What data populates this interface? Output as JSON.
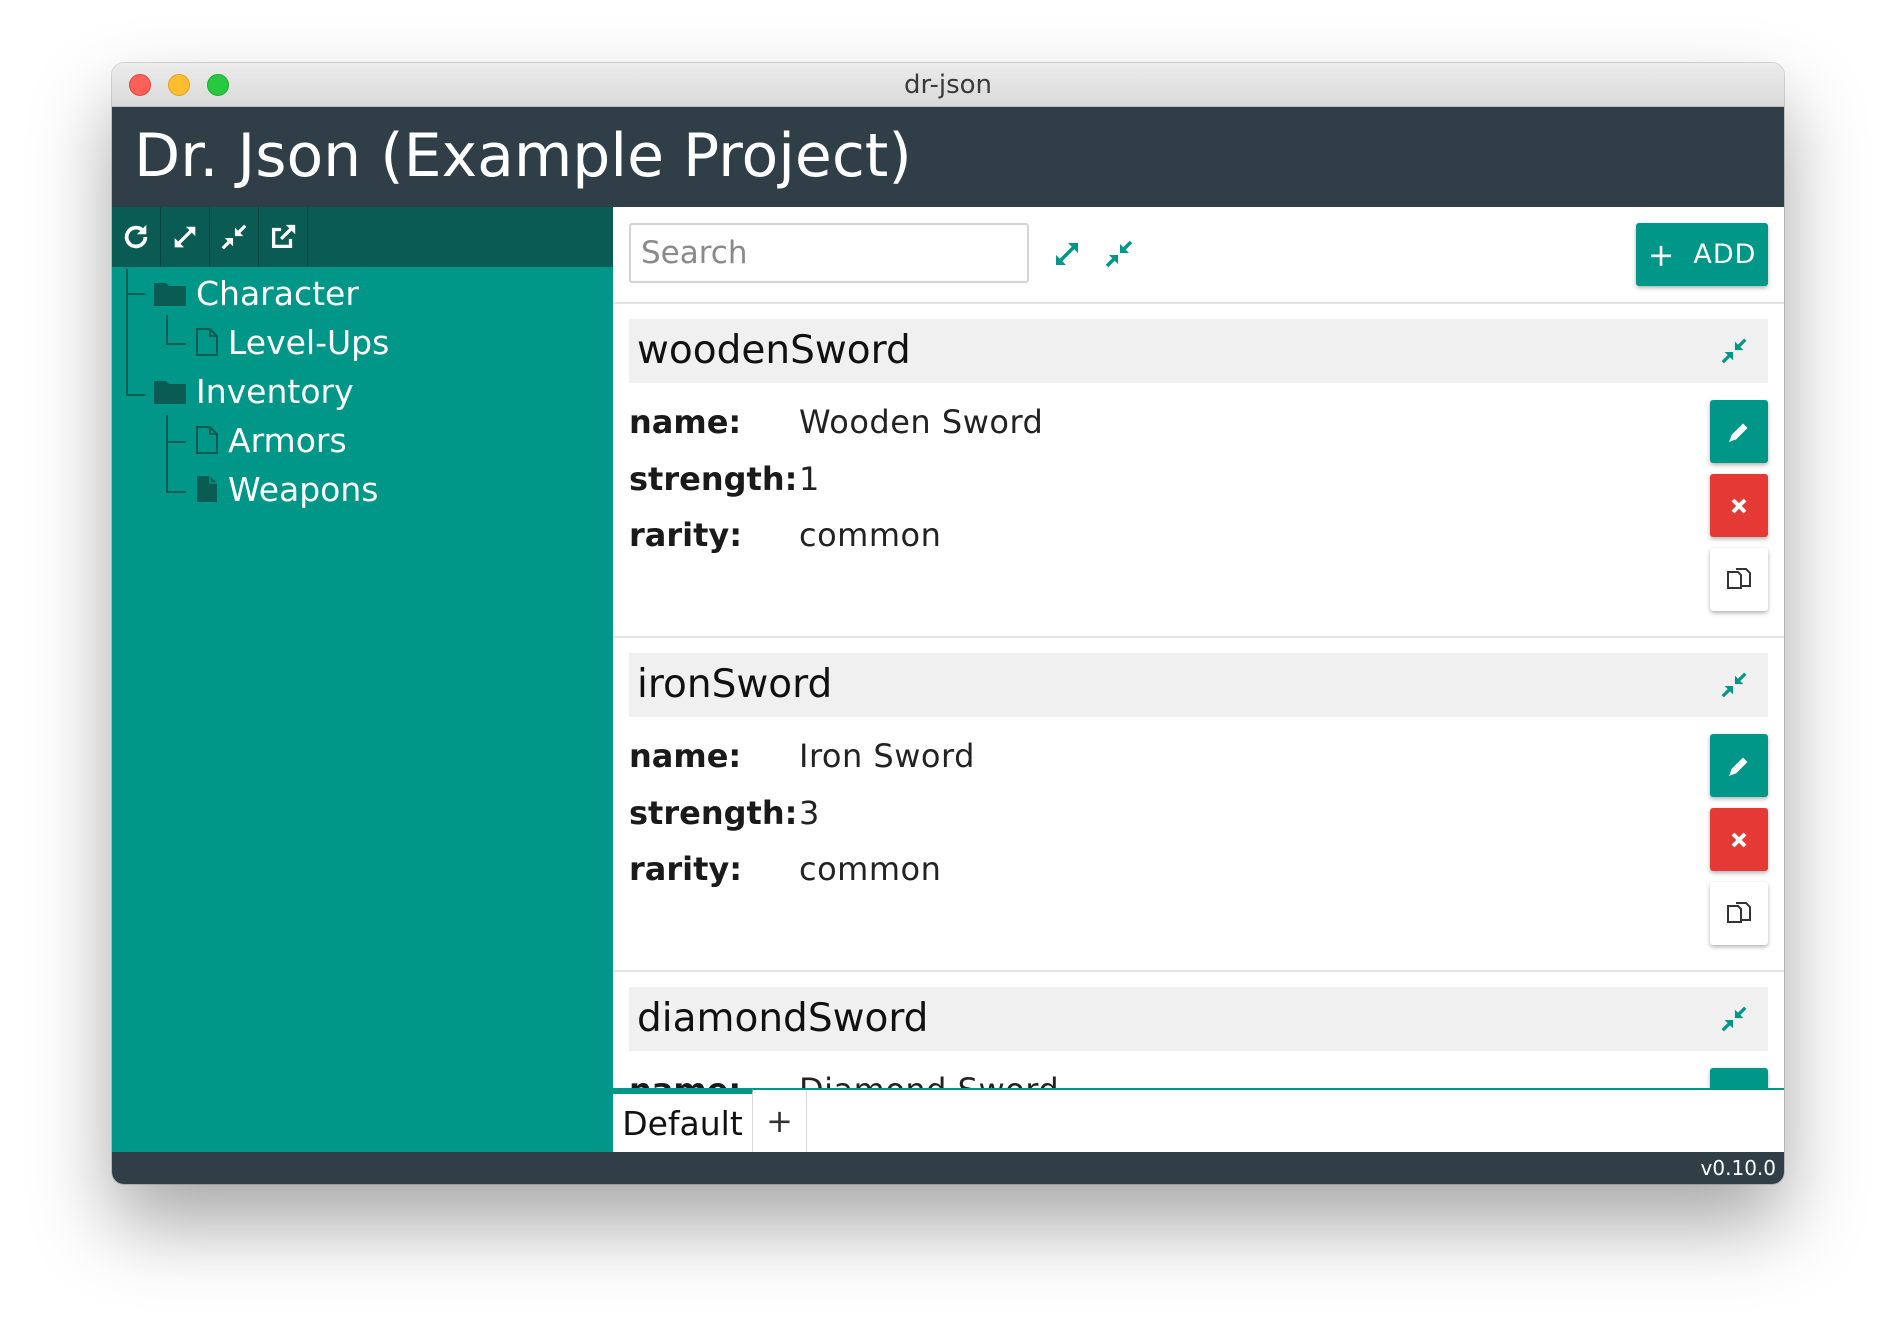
{
  "window": {
    "title": "dr-json"
  },
  "app": {
    "title": "Dr. Json (Example Project)"
  },
  "sidebar": {
    "toolbar": [
      {
        "name": "refresh-icon"
      },
      {
        "name": "expand-all-icon"
      },
      {
        "name": "collapse-all-icon"
      },
      {
        "name": "open-external-icon"
      }
    ],
    "tree": [
      {
        "label": "Character",
        "type": "folder"
      },
      {
        "label": "Level-Ups",
        "type": "file"
      },
      {
        "label": "Inventory",
        "type": "folder"
      },
      {
        "label": "Armors",
        "type": "file"
      },
      {
        "label": "Weapons",
        "type": "file",
        "selected": true
      }
    ]
  },
  "main": {
    "search": {
      "placeholder": "Search",
      "value": ""
    },
    "add_button": {
      "icon": "+",
      "label": "ADD"
    },
    "records": [
      {
        "id": "woodenSword",
        "fields": [
          {
            "key": "name:",
            "value": "Wooden Sword"
          },
          {
            "key": "strength:",
            "value": "1"
          },
          {
            "key": "rarity:",
            "value": "common"
          }
        ]
      },
      {
        "id": "ironSword",
        "fields": [
          {
            "key": "name:",
            "value": "Iron Sword"
          },
          {
            "key": "strength:",
            "value": "3"
          },
          {
            "key": "rarity:",
            "value": "common"
          }
        ]
      },
      {
        "id": "diamondSword",
        "fields": [
          {
            "key": "name:",
            "value": "Diamond Sword"
          }
        ]
      }
    ]
  },
  "tabs": {
    "items": [
      {
        "label": "Default",
        "active": true
      }
    ],
    "add_label": "+"
  },
  "status": {
    "version": "v0.10.0"
  },
  "colors": {
    "accent": "#009688",
    "accent_dark": "#0a5b53",
    "header": "#2f3e47",
    "danger": "#e53935"
  }
}
